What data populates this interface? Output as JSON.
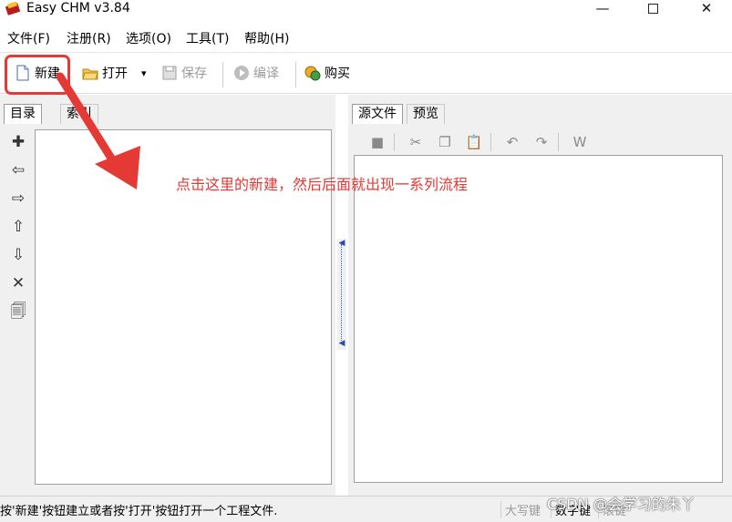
{
  "window": {
    "title": "Easy CHM v3.84",
    "min_glyph": "—",
    "close_glyph": "✕"
  },
  "menu": {
    "items": [
      "文件(F)",
      "注册(R)",
      "选项(O)",
      "工具(T)",
      "帮助(H)"
    ]
  },
  "toolbar": {
    "new_label": "新建",
    "open_label": "打开",
    "dropdown_glyph": "▾",
    "save_label": "保存",
    "compile_label": "编译",
    "buy_label": "购买"
  },
  "left_panel": {
    "tabs": [
      "目录",
      "索引"
    ]
  },
  "right_panel": {
    "tabs": [
      "源文件",
      "预览"
    ]
  },
  "annotation": {
    "text": "点击这里的新建，然后后面就出现一系列流程",
    "color": "#e53935"
  },
  "status": {
    "message": "按'新建'按钮建立或者按'打开'按钮打开一个工程文件.",
    "caps": "大写键",
    "num": "数字键",
    "scroll": "滚键"
  },
  "watermark": "CSDN @会学习的朱丫"
}
